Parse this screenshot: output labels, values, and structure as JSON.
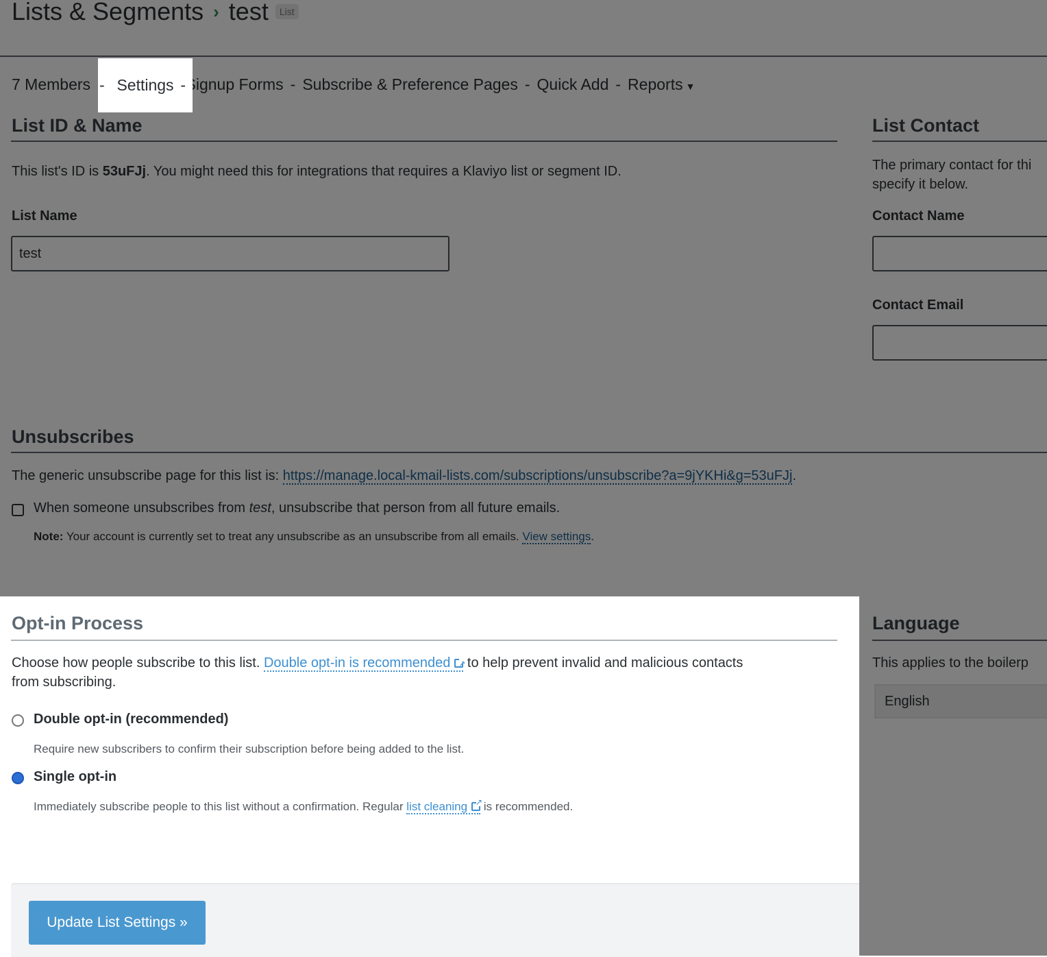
{
  "header": {
    "breadcrumb_root": "Lists & Segments",
    "breadcrumb_current": "test",
    "badge": "List"
  },
  "tabs": [
    {
      "label": "7 Members"
    },
    {
      "label": "Settings",
      "active": true
    },
    {
      "label": "Signup Forms"
    },
    {
      "label": "Subscribe & Preference Pages"
    },
    {
      "label": "Quick Add"
    },
    {
      "label": "Reports"
    }
  ],
  "tab_separator": "-",
  "list_id_section": {
    "title": "List ID & Name",
    "desc_prefix": "This list's ID is ",
    "list_id": "53uFJj",
    "desc_suffix": ". You might need this for integrations that requires a Klaviyo list or segment ID.",
    "name_label": "List Name",
    "name_value": "test"
  },
  "list_contact": {
    "title": "List Contact",
    "desc_line1": "The primary contact for thi",
    "desc_line2": "specify it below.",
    "name_label": "Contact Name",
    "name_value": "",
    "email_label": "Contact Email",
    "email_value": ""
  },
  "unsubscribes": {
    "title": "Unsubscribes",
    "desc_prefix": "The generic unsubscribe page for this list is: ",
    "url": "https://manage.local-kmail-lists.com/subscriptions/unsubscribe?a=9jYKHi&g=53uFJj",
    "desc_suffix": ".",
    "checkbox_prefix": "When someone unsubscribes from ",
    "checkbox_list": "test",
    "checkbox_suffix": ", unsubscribe that person from all future emails.",
    "checkbox_checked": false,
    "note_label": "Note:",
    "note_text": " Your account is currently set to treat any unsubscribe as an unsubscribe from all emails. ",
    "note_link": "View settings",
    "note_end": "."
  },
  "optin": {
    "title": "Opt-in Process",
    "desc_prefix": "Choose how people subscribe to this list. ",
    "desc_link": "Double opt-in is recommended",
    "desc_suffix": " to help prevent invalid and malicious contacts",
    "desc_line2": "from subscribing.",
    "options": [
      {
        "label": "Double opt-in (recommended)",
        "selected": false,
        "help": "Require new subscribers to confirm their subscription before being added to the list."
      },
      {
        "label": "Single opt-in",
        "selected": true,
        "help_prefix": "Immediately subscribe people to this list without a confirmation. Regular ",
        "help_link": "list cleaning",
        "help_suffix": " is recommended."
      }
    ],
    "submit_label": "Update List Settings »"
  },
  "language": {
    "title": "Language",
    "desc": "This applies to the boilerp",
    "selected": "English"
  },
  "colors": {
    "link": "#3d8fd1",
    "radio_selected": "#2c6ed5",
    "button": "#4a98d0",
    "breadcrumb_chevron": "#2e8b57"
  }
}
